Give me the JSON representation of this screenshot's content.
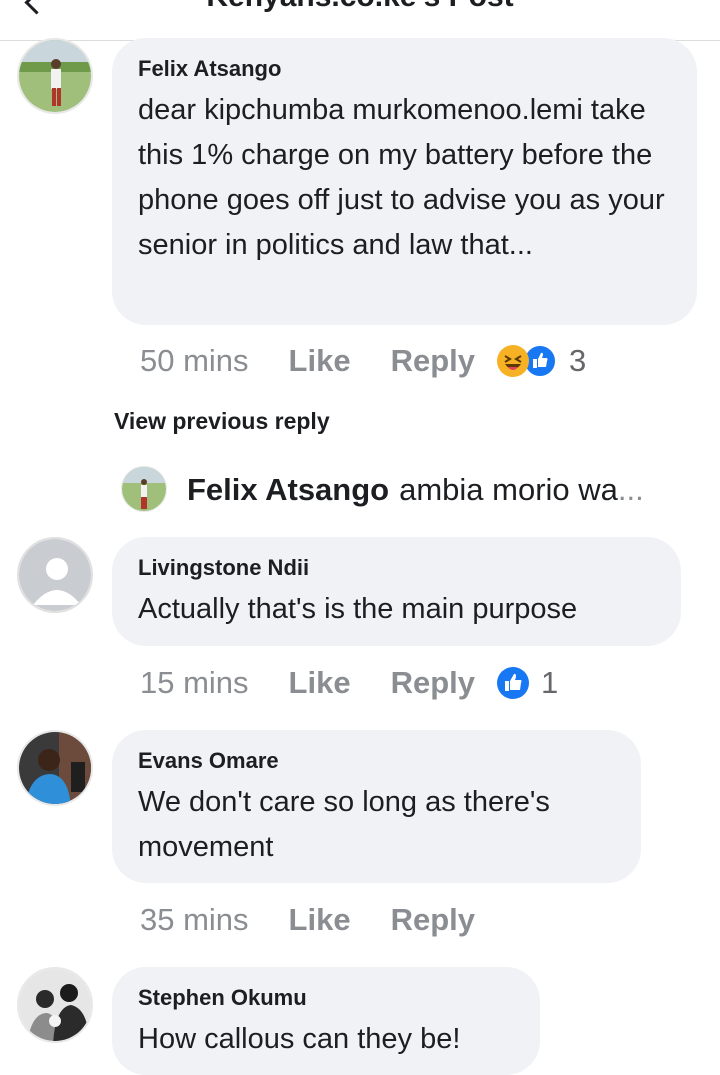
{
  "header": {
    "title": "Kenyans.co.ke's Post"
  },
  "comments": [
    {
      "author": "Felix Atsango",
      "text": "dear kipchumba murkomenoo.lemi take this 1% charge on my battery before the phone goes off just to advise you as your senior in politics and law that...",
      "time": "50 mins",
      "like": "Like",
      "reply": "Reply",
      "reaction_count": "3",
      "reactions": [
        "haha-icon",
        "like-icon"
      ]
    },
    {
      "author": "Livingstone Ndii",
      "text": "Actually that's is the main purpose",
      "time": "15 mins",
      "like": "Like",
      "reply": "Reply",
      "reaction_count": "1",
      "reactions": [
        "like-icon"
      ]
    },
    {
      "author": "Evans Omare",
      "text": "We don't care so long as there's movement",
      "time": "35 mins",
      "like": "Like",
      "reply": "Reply"
    },
    {
      "author": "Stephen Okumu",
      "text": "How callous can they be!"
    }
  ],
  "view_previous": "View previous reply",
  "reply_preview": {
    "author": "Felix Atsango",
    "text": "ambia morio wa",
    "ellipsis": "..."
  },
  "colors": {
    "bubble": "#f0f2f5",
    "like_blue": "#1877f2",
    "haha_yellow": "#f7b125",
    "meta_gray": "#8a8d91"
  }
}
